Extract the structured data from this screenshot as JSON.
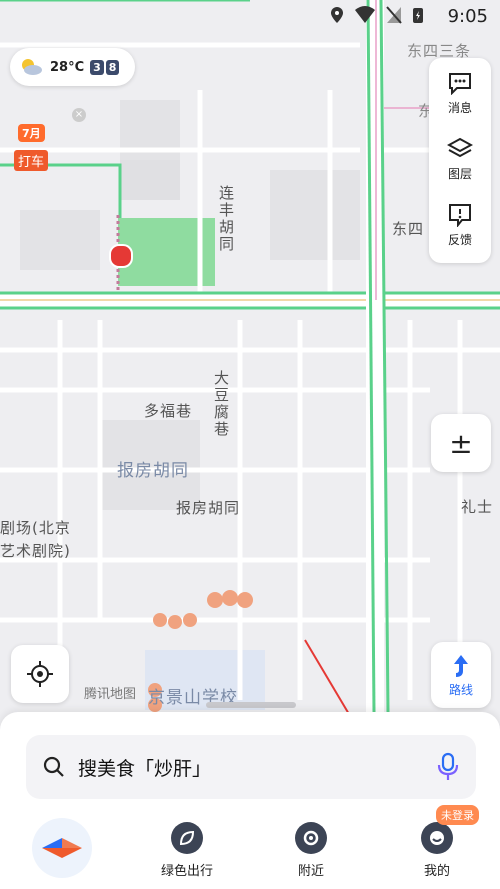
{
  "status_bar": {
    "time": "9:05"
  },
  "weather": {
    "temp": "28°C",
    "aqi": [
      "3",
      "8"
    ],
    "icon": "partly-cloudy-icon"
  },
  "taxi": {
    "tag": "7月",
    "label": "打车"
  },
  "right_panel": {
    "items": [
      {
        "label": "消息",
        "icon": "message-icon"
      },
      {
        "label": "图层",
        "icon": "layers-icon"
      },
      {
        "label": "反馈",
        "icon": "feedback-icon"
      }
    ]
  },
  "zoom": {
    "label": "±"
  },
  "route": {
    "label": "路线"
  },
  "map_labels": {
    "lianfeng": "连丰胡同",
    "dongsi": "东四",
    "dongsi_top": "东四三条",
    "dongsi_right": "东",
    "dadoufu": "大豆腐巷",
    "duofu": "多福巷",
    "baofang_big": "报房胡同",
    "baofang": "报房胡同",
    "lishi": "礼士",
    "theatre_1": "剧场(北京",
    "theatre_2": "艺术剧院)",
    "school": "京景山学校",
    "watermark": "腾讯地图"
  },
  "search": {
    "placeholder": "搜美食「炒肝」"
  },
  "bottom_nav": {
    "items": [
      {
        "label": "",
        "icon": "app-logo-icon"
      },
      {
        "label": "绿色出行",
        "icon": "leaf-icon"
      },
      {
        "label": "附近",
        "icon": "location-pin-icon"
      },
      {
        "label": "我的",
        "icon": "avatar-icon"
      }
    ],
    "badge": "未登录"
  },
  "colors": {
    "accent": "#2a6df4",
    "road_green": "#5ad18a",
    "annotation": "#e53935"
  }
}
